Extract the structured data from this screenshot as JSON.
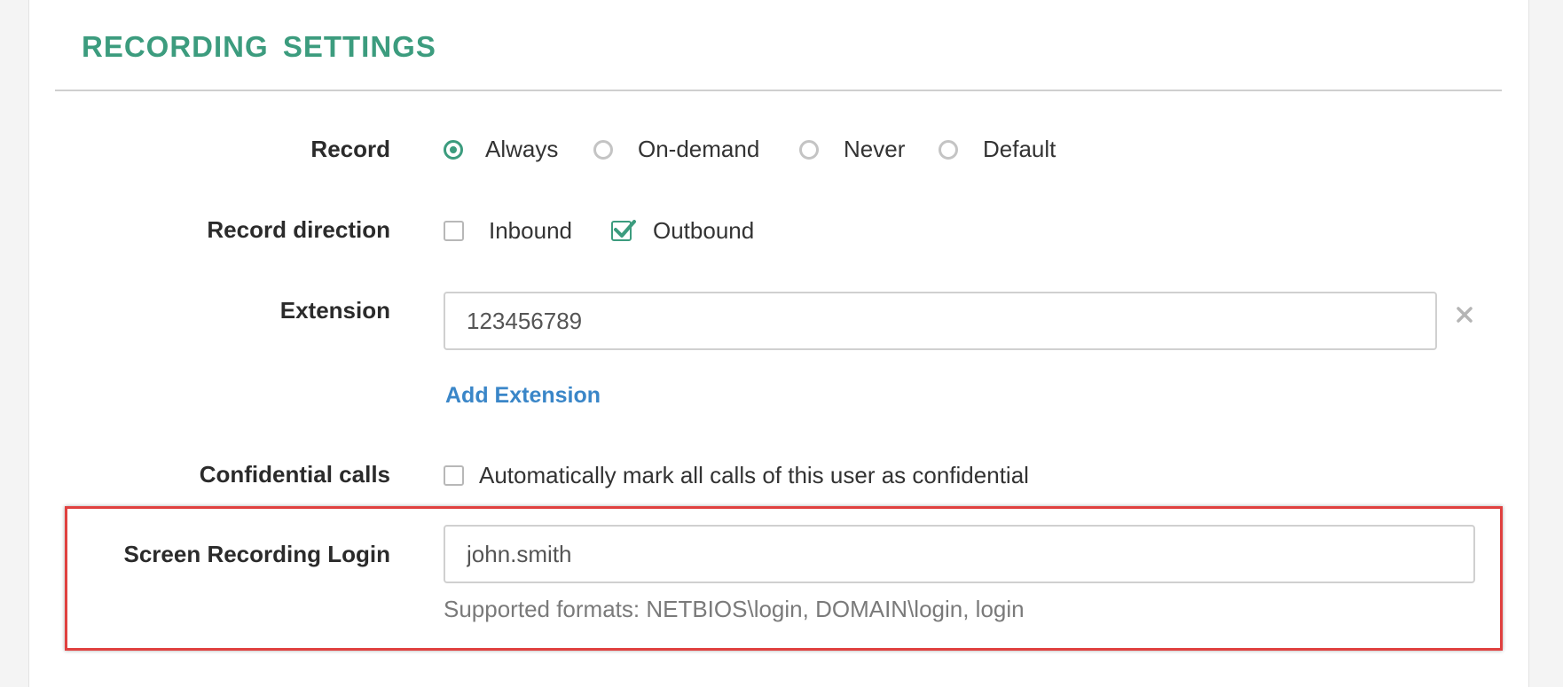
{
  "section": {
    "title": "RECORDING SETTINGS"
  },
  "record": {
    "label": "Record",
    "options": [
      {
        "label": "Always",
        "checked": true
      },
      {
        "label": "On-demand",
        "checked": false
      },
      {
        "label": "Never",
        "checked": false
      },
      {
        "label": "Default",
        "checked": false
      }
    ]
  },
  "record_direction": {
    "label": "Record direction",
    "options": [
      {
        "label": "Inbound",
        "checked": false
      },
      {
        "label": "Outbound",
        "checked": true
      }
    ]
  },
  "extension": {
    "label": "Extension",
    "value": "123456789",
    "clear_icon": "close-icon",
    "add_label": "Add Extension"
  },
  "confidential": {
    "label": "Confidential calls",
    "checkbox_label": "Automatically mark all calls of this user as confidential",
    "checked": false
  },
  "screen_recording": {
    "label": "Screen Recording Login",
    "value": "john.smith",
    "help": "Supported formats: NETBIOS\\login, DOMAIN\\login, login"
  },
  "colors": {
    "accent": "#3c9c7e",
    "link": "#3a86c8",
    "highlight_border": "#e0403f"
  }
}
